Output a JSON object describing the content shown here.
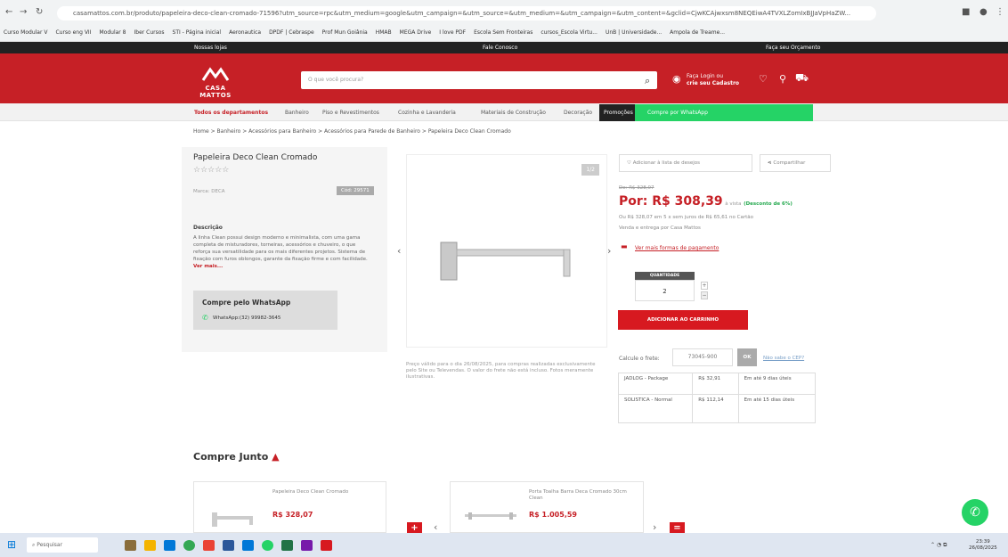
{
  "browser": {
    "url": "casamattos.com.br/produto/papeleira-deco-clean-cromado-71596?utm_source=rpc&utm_medium=google&utm_campaign=&utm_source=&utm_medium=&utm_campaign=&utm_content=&gclid=CjwKCAjwxsm8NEQEiwA4TVXLZomIxBJJaVpHaZW...",
    "bookmarks": [
      "Curso Modular V",
      "Curso eng VII",
      "Modular 8",
      "Iber Cursos",
      "STI - Página inicial",
      "Aeronautica",
      "DPDF | Cebraspe",
      "Prof Mun Goiânia",
      "HMAB",
      "MEGA Drive",
      "I love PDF",
      "Escola Sem Fronteiras",
      "cursos_Escola Virtu...",
      "UnB | Universidade...",
      "Ampola de Treame..."
    ]
  },
  "site": {
    "top_left": "Nossas lojas",
    "top_center": "Fale Conosco",
    "top_right": "Faça seu Orçamento",
    "logo": "CASA MATTOS",
    "search_placeholder": "O que você procura?",
    "login_line1": "Faça Login ou",
    "login_line2": "crie seu Cadastro",
    "categories": [
      "Todos os departamentos",
      "Banheiro",
      "Piso e Revestimentos",
      "Cozinha e Lavanderia",
      "Materiais de Construção",
      "Decoração",
      "Promoções",
      "Compre por WhatsApp"
    ],
    "breadcrumb": "Home > Banheiro > Acessórios para Banheiro > Acessórios para Parede de Banheiro > Papeleira Deco Clean Cromado"
  },
  "product": {
    "title": "Papeleira Deco Clean Cromado",
    "stars": "☆☆☆☆☆",
    "brand": "Marca: DECA",
    "code": "Cód: 29571",
    "desc_title": "Descrição",
    "desc": "A linha Clean possui design moderno e minimalista, com uma gama completa de misturadores, torneiras, acessórios e chuveiro, o que reforça sua versatilidade para os mais diferentes projetos. Sistema de fixação com furos oblongos, garante da fixação firme e com facilidade.",
    "see_more": "Ver mais...",
    "wa_title": "Compre pelo WhatsApp",
    "wa_number": "WhatsApp:(32) 99982-3645",
    "img_counter": "1/2",
    "price_note": "Preço válido para o dia 26/08/2025, para compras realizadas exclusivamente pelo Site ou Televendas. O valor do frete não está incluso. Fotos meramente ilustrativas.",
    "wishlist": "Adicionar à lista de desejos",
    "share": "Compartilhar",
    "old_price": "De: R$ 328,07",
    "price": "Por: R$ 308,39",
    "price_suffix": "à vista",
    "discount": "(Desconto de 6%)",
    "installments": "Ou R$ 328,07 em 5 x sem juros de R$ 65,61 no Cartão",
    "installments2": "Venda e entrega por Casa Mattos",
    "payment_link": "Ver mais formas de pagamento",
    "qty_label": "QUANTIDADE",
    "qty": "2",
    "qty_plus": "+",
    "qty_minus": "−",
    "add_cart": "ADICIONAR AO CARRINHO",
    "freight_label": "Calcule o frete:",
    "cep": "73045-900",
    "ok": "OK",
    "cep_link": "Não sabe o CEP?",
    "shipping": [
      {
        "carrier": "JADLOG - Package",
        "price": "R$ 32,91",
        "time": "Em até 9 dias úteis"
      },
      {
        "carrier": "SOLISTICA - Normal",
        "price": "R$ 112,14",
        "time": "Em até 15 dias úteis"
      }
    ]
  },
  "together": {
    "title": "Compre Junto",
    "items": [
      {
        "name": "Papeleira Deco Clean Cromado",
        "price": "R$ 328,07"
      },
      {
        "name": "Porta Toalha Barra Deca Cromado 30cm Clean",
        "price": "R$ 1.005,59"
      }
    ]
  },
  "taskbar": {
    "search": "Pesquisar",
    "time": "23:39",
    "date": "26/08/2025"
  },
  "colors": {
    "brand_red": "#c62026",
    "whatsapp_green": "#25d366",
    "dark_bar": "#222222"
  }
}
